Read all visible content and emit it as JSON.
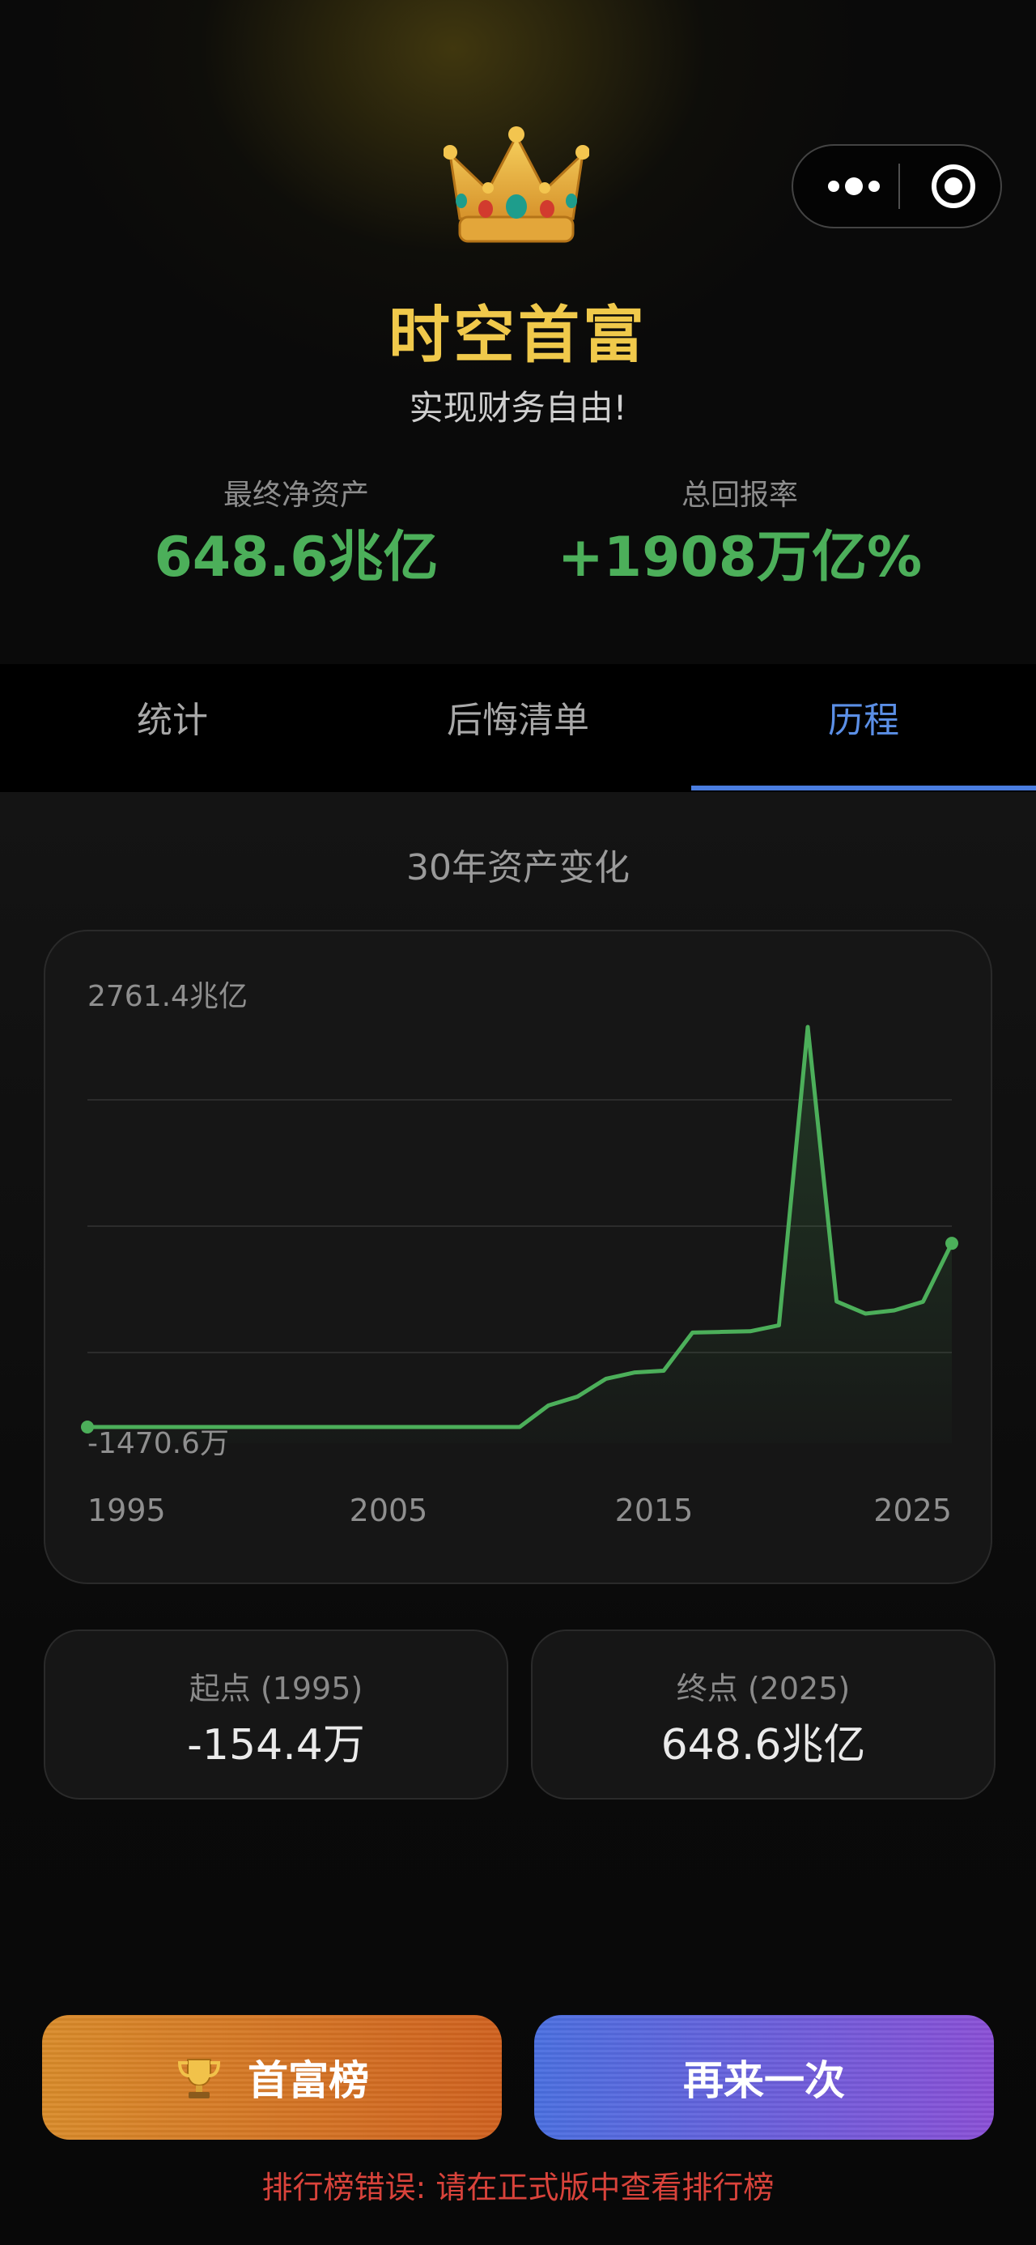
{
  "header": {
    "title": "时空首富",
    "subtitle": "实现财务自由!",
    "crown_icon": "crown-icon"
  },
  "capsule": {
    "more_icon": "more-dots-icon",
    "close_icon": "target-circle-icon"
  },
  "stats": {
    "net_worth_label": "最终净资产",
    "net_worth_value": "648.6兆亿",
    "return_label": "总回报率",
    "return_value": "+1908万亿%"
  },
  "tabs": [
    {
      "label": "统计",
      "active": false
    },
    {
      "label": "后悔清单",
      "active": false
    },
    {
      "label": "历程",
      "active": true
    }
  ],
  "section_title": "30年资产变化",
  "chart_data": {
    "type": "area",
    "x": [
      1995,
      1996,
      1997,
      1998,
      1999,
      2000,
      2001,
      2002,
      2003,
      2004,
      2005,
      2006,
      2007,
      2008,
      2009,
      2010,
      2011,
      2012,
      2013,
      2014,
      2015,
      2016,
      2017,
      2018,
      2019,
      2020,
      2021,
      2022,
      2023,
      2024,
      2025
    ],
    "series": [
      {
        "values": [
          -0.154,
          -0.154,
          -0.154,
          -0.154,
          -0.154,
          -0.154,
          -0.154,
          -0.154,
          -0.154,
          -0.154,
          -0.154,
          -0.154,
          -0.154,
          -0.154,
          -0.154,
          -0.154,
          0.5,
          1.5,
          6,
          9,
          10,
          73,
          75,
          77,
          98,
          2761.4,
          215,
          149,
          165,
          213,
          648.6
        ]
      }
    ],
    "y_unit": "兆亿",
    "y_max_label": "2761.4兆亿",
    "y_min_label": "-1470.6万",
    "x_tick_labels": [
      "1995",
      "2005",
      "2015",
      "2025"
    ],
    "line_color": "#4caf5a",
    "grid": true
  },
  "start_card": {
    "label": "起点 (1995)",
    "value": "-154.4万"
  },
  "end_card": {
    "label": "终点 (2025)",
    "value": "648.6兆亿"
  },
  "buttons": {
    "rank_label": "首富榜",
    "rank_icon": "trophy-icon",
    "again_label": "再来一次"
  },
  "error_message": "排行榜错误: 请在正式版中查看排行榜",
  "colors": {
    "gold": "#f0c94b",
    "green": "#4caf5a",
    "blue": "#5b8fe6",
    "error": "#d9433b"
  }
}
